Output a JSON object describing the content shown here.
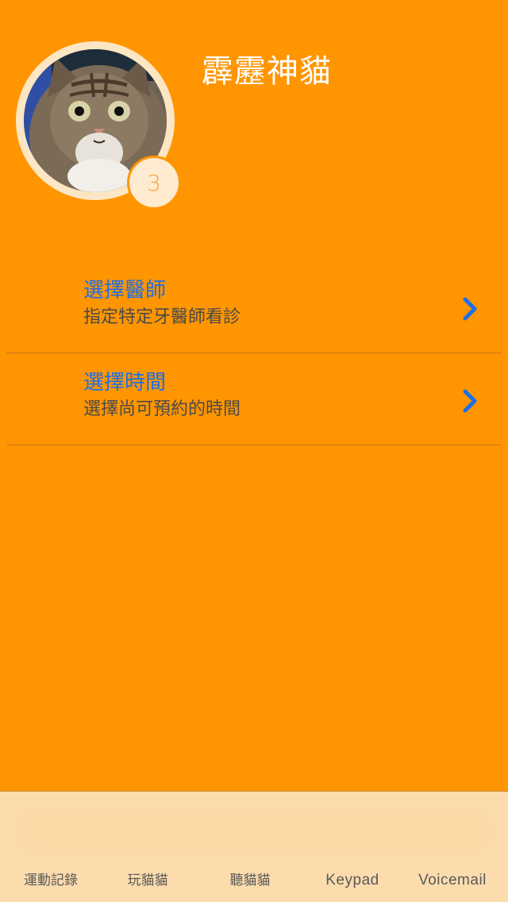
{
  "profile": {
    "name": "霹靂神貓",
    "badge_count": "3"
  },
  "menu": {
    "items": [
      {
        "title": "選擇醫師",
        "subtitle": "指定特定牙醫師看診"
      },
      {
        "title": "選擇時間",
        "subtitle": "選擇尚可預約的時間"
      }
    ]
  },
  "tabbar": {
    "tabs": [
      {
        "label": "運動記錄"
      },
      {
        "label": "玩貓貓"
      },
      {
        "label": "聽貓貓"
      },
      {
        "label": "Keypad"
      },
      {
        "label": "Voicemail"
      }
    ]
  },
  "colors": {
    "background": "#FF9500",
    "accent": "#1D6FE8",
    "tabbar": "#FCDCAD",
    "badge_text": "#F6A33A"
  },
  "icons": {
    "row_chevron": "chevron-right-icon",
    "avatar": "cat-photo"
  }
}
